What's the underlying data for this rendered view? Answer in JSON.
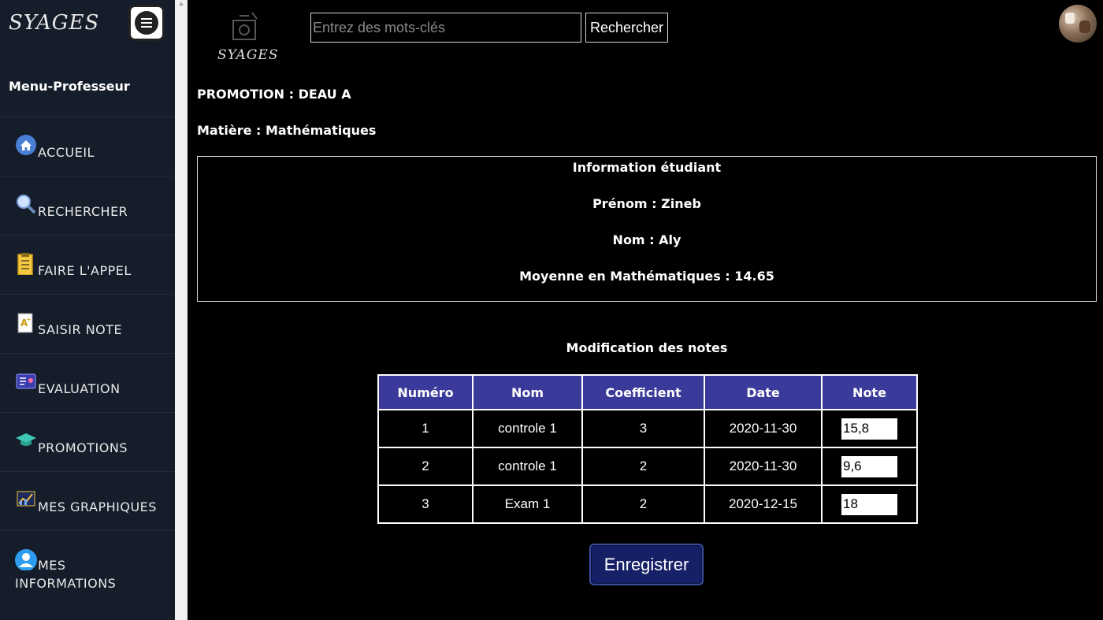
{
  "sidebar": {
    "brand": "SYAGES",
    "menu_title": "Menu-Professeur",
    "items": [
      {
        "label": "ACCUEIL",
        "icon": "home-icon"
      },
      {
        "label": "RECHERCHER",
        "icon": "search-icon"
      },
      {
        "label": "FAIRE L'APPEL",
        "icon": "clipboard-icon"
      },
      {
        "label": "SAISIR NOTE",
        "icon": "grade-document-icon"
      },
      {
        "label": "EVALUATION",
        "icon": "evaluation-card-icon"
      },
      {
        "label": "PROMOTIONS",
        "icon": "graduation-cap-icon"
      },
      {
        "label": "MES GRAPHIQUES",
        "icon": "chart-icon"
      },
      {
        "label": "MES INFORMATIONS",
        "icon": "user-icon"
      }
    ]
  },
  "header": {
    "logo_text": "SYAGES",
    "search_placeholder": "Entrez des mots-clés",
    "search_button": "Rechercher"
  },
  "main": {
    "promotion": "PROMOTION : DEAU A",
    "matiere": "Matière : Mathématiques",
    "info": {
      "title": "Information étudiant",
      "prenom": "Prénom : Zineb",
      "nom": "Nom : Aly",
      "moyenne": "Moyenne en Mathématiques : 14.65"
    },
    "modif_title": "Modification des notes",
    "table": {
      "headers": [
        "Numéro",
        "Nom",
        "Coefficient",
        "Date",
        "Note"
      ],
      "rows": [
        {
          "numero": "1",
          "nom": "controle 1",
          "coef": "3",
          "date": "2020-11-30",
          "note": "15,8"
        },
        {
          "numero": "2",
          "nom": "controle 1",
          "coef": "2",
          "date": "2020-11-30",
          "note": "9,6"
        },
        {
          "numero": "3",
          "nom": "Exam 1",
          "coef": "2",
          "date": "2020-12-15",
          "note": "18"
        }
      ]
    },
    "save_button": "Enregistrer"
  }
}
